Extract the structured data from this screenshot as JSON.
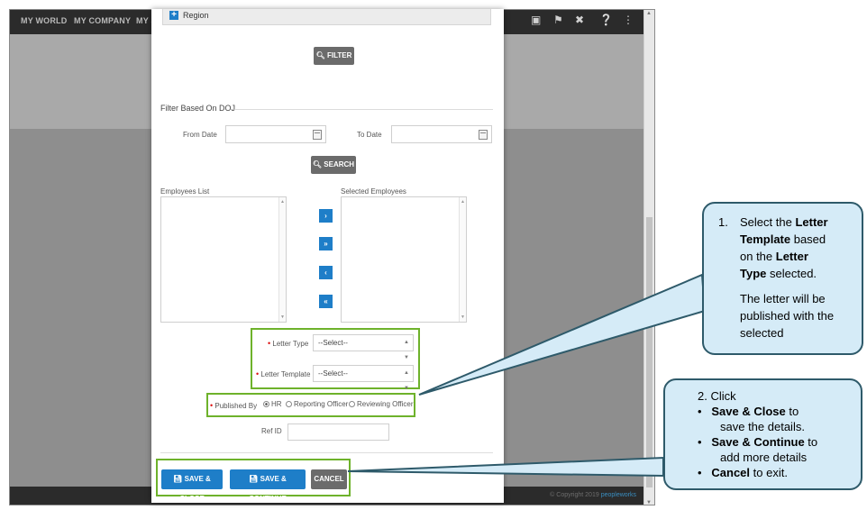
{
  "nav": {
    "item1": "MY WORLD",
    "item2": "MY COMPANY",
    "item3": "MY S"
  },
  "top_icons": [
    "book-icon",
    "flag-icon",
    "tools-icon",
    "help-icon",
    "share-icon"
  ],
  "footer": {
    "copyright": "© Copyright 2019",
    "brand": "peopleworks"
  },
  "modal": {
    "region_label": "Region",
    "filter_button": "FILTER",
    "doj_title": "Filter Based On DOJ",
    "from_date_label": "From Date",
    "to_date_label": "To Date",
    "search_button": "SEARCH",
    "employees_list_label": "Employees List",
    "selected_employees_label": "Selected Employees",
    "move_buttons": [
      "›",
      "»",
      "‹",
      "«"
    ],
    "letter_type_label": "Letter Type",
    "letter_type_value": "--Select--",
    "letter_template_label": "Letter Template",
    "letter_template_value": "--Select--",
    "published_by_label": "Published By",
    "published_options": [
      "HR",
      "Reporting Officer",
      "Reviewing Officer"
    ],
    "published_selected": "HR",
    "ref_id_label": "Ref ID",
    "save_close_button": "SAVE & CLOSE",
    "save_continue_button": "SAVE & CONTINUE",
    "cancel_button": "CANCEL"
  },
  "callout1": {
    "number": "1.",
    "line1a": "Select the ",
    "line1b": "Letter",
    "line2": "Template",
    "line2b": " based",
    "line3a": "on the ",
    "line3b": "Letter",
    "line4": "Type",
    "line4b": " selected.",
    "para2_line1": "The letter will be",
    "para2_line2": "published with the",
    "para2_line3": "selected"
  },
  "callout2": {
    "line1": "2.  Click",
    "b1_bold": "Save & Close",
    "b1_rest": " to",
    "b1_line2": "save the details.",
    "b2_bold": "Save & Continue",
    "b2_rest": " to",
    "b2_line2": "add more details",
    "b3_bold": "Cancel",
    "b3_rest": " to exit."
  },
  "colors": {
    "accent_blue": "#1e7ec8",
    "highlight_green": "#6eb22b",
    "callout_fill": "#d5ebf7",
    "callout_border": "#2e5a6a"
  }
}
